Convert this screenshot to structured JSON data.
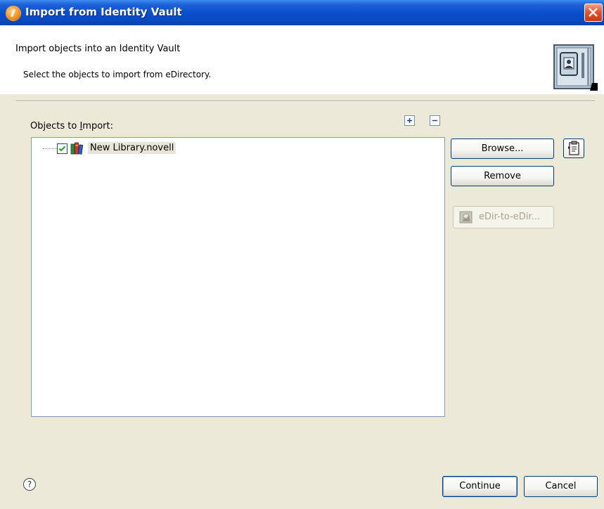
{
  "window": {
    "title": "Import from Identity Vault"
  },
  "banner": {
    "heading": "Import objects into an Identity Vault",
    "subtitle": "Select the objects to import from eDirectory."
  },
  "objects": {
    "label_prefix": "Objects to ",
    "label_mnemonic": "I",
    "label_suffix": "mport:",
    "items": [
      {
        "label": "New Library.novell",
        "checked": true,
        "icon": "library-books-icon"
      }
    ]
  },
  "buttons": {
    "browse": "Browse...",
    "remove": "Remove",
    "edir": "eDir-to-eDir...",
    "continue": "Continue",
    "cancel": "Cancel"
  },
  "icons": {
    "expand_all": "expand-all-icon",
    "collapse_all": "collapse-all-icon",
    "help": "help-icon",
    "close": "close-icon"
  },
  "colors": {
    "titlebar": "#0a4fcc",
    "dialog_bg": "#ece9d8",
    "close_button": "#e2542e"
  }
}
